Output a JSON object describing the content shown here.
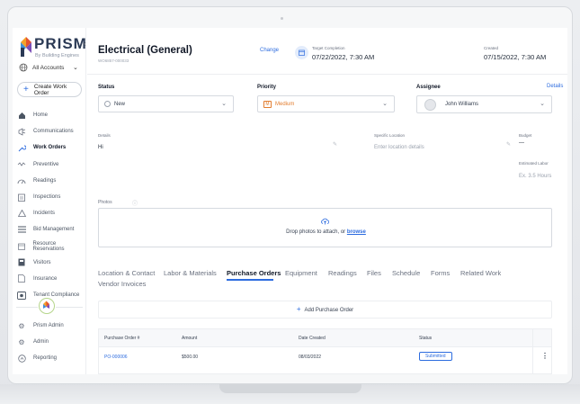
{
  "sidebar": {
    "brand": "PRISM",
    "brand_sub": "By Building Engines",
    "accounts": "All Accounts",
    "create_label": "Create Work Order",
    "items": [
      {
        "label": "Home",
        "icon": "home-icon"
      },
      {
        "label": "Communications",
        "icon": "megaphone-icon"
      },
      {
        "label": "Work Orders",
        "icon": "wrench-icon",
        "active": true
      },
      {
        "label": "Preventive",
        "icon": "preventive-icon"
      },
      {
        "label": "Readings",
        "icon": "gauge-icon"
      },
      {
        "label": "Inspections",
        "icon": "clipboard-icon"
      },
      {
        "label": "Incidents",
        "icon": "warning-icon"
      },
      {
        "label": "Bid Management",
        "icon": "list-icon"
      },
      {
        "label": "Resource Reservations",
        "icon": "calendar-icon"
      },
      {
        "label": "Visitors",
        "icon": "badge-icon"
      },
      {
        "label": "Insurance",
        "icon": "document-icon"
      },
      {
        "label": "Tenant Compliance",
        "icon": "compliance-icon"
      }
    ],
    "bottom_items": [
      {
        "label": "Prism Admin",
        "icon": "gear-icon"
      },
      {
        "label": "Admin",
        "icon": "gear-icon"
      },
      {
        "label": "Reporting",
        "icon": "report-icon"
      }
    ]
  },
  "header": {
    "title": "Electrical (General)",
    "wo_id": "WO6857-000033",
    "change": "Change",
    "target_label": "Target Completion",
    "target_value": "07/22/2022, 7:30 AM",
    "created_label": "Created",
    "created_value": "07/15/2022, 7:30 AM"
  },
  "fields": {
    "status_label": "Status",
    "status_value": "New",
    "priority_label": "Priority",
    "priority_value": "Medium",
    "priority_code": "M",
    "assignee_label": "Assignee",
    "assignee_value": "John Williams",
    "details_link": "Details",
    "details_label": "Details",
    "details_value": "Hi",
    "location_label": "Specific Location",
    "location_placeholder": "Enter location details",
    "budget_label": "Budget",
    "budget_value": "—",
    "labor_label": "Estimated Labor",
    "labor_value": "Ex. 3.5 Hours"
  },
  "photos": {
    "label": "Photos",
    "drop_text": "Drop photos to attach, or ",
    "browse": "browse"
  },
  "tabs": [
    "Location & Contact",
    "Labor & Materials",
    "Purchase Orders",
    "Equipment",
    "Readings",
    "Files",
    "Schedule",
    "Forms",
    "Related Work",
    "Vendor Invoices"
  ],
  "active_tab": "Purchase Orders",
  "purchase_orders": {
    "add_label": "Add Purchase Order",
    "columns": [
      "Purchase Order #",
      "Amount",
      "Date Created",
      "Status"
    ],
    "rows": [
      {
        "number": "PO-000006",
        "amount": "$500.00",
        "date": "08/03/2022",
        "status": "Submitted"
      }
    ]
  },
  "colors": {
    "accent": "#2d6cdf",
    "priority": "#e27d2f"
  }
}
